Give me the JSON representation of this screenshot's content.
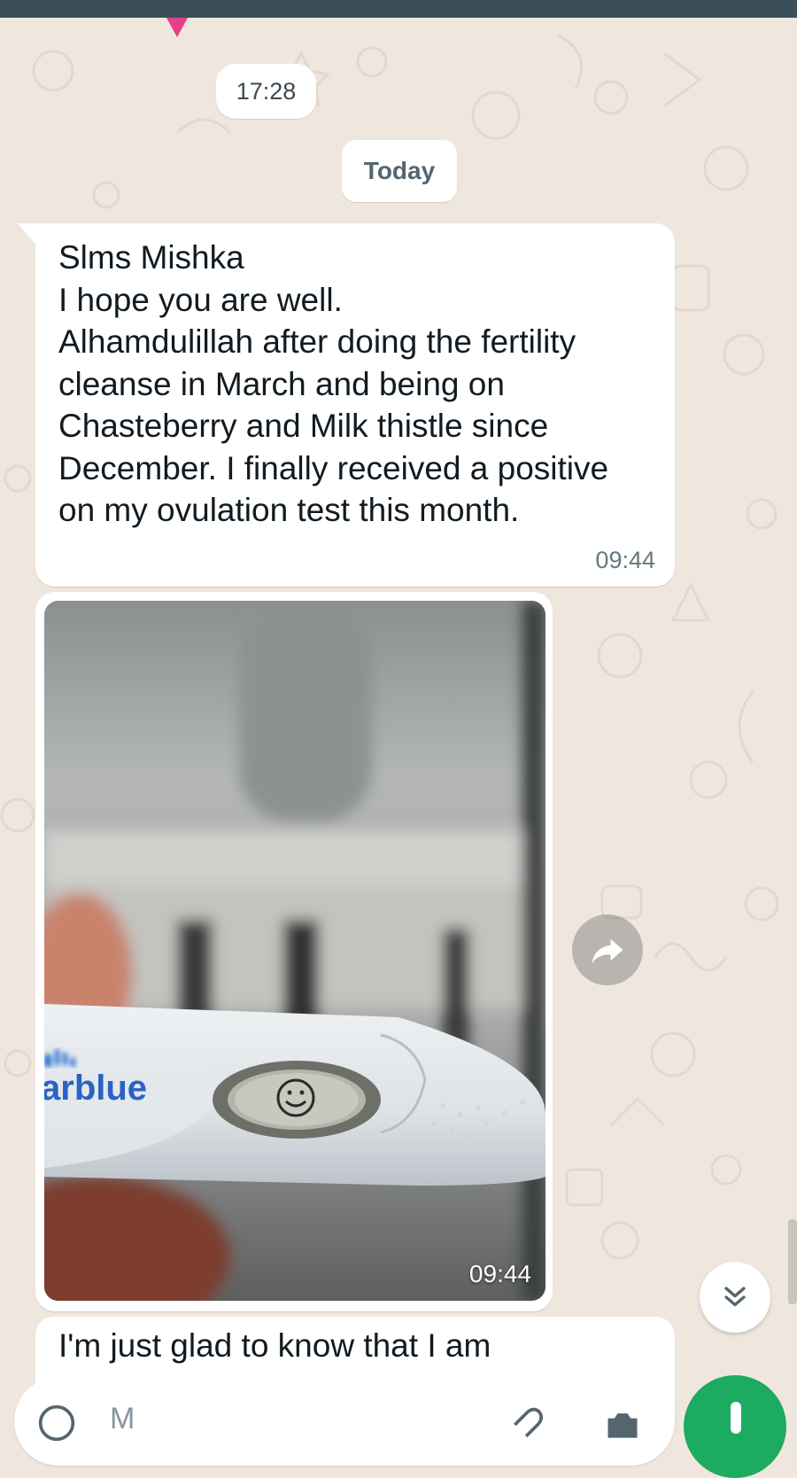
{
  "chat": {
    "time_pill": "17:28",
    "date_divider": "Today",
    "messages": [
      {
        "text": "Slms Mishka\nI hope you are well.\nAlhamdulillah after doing the fertility\ncleanse in March and being on\nChasteberry and Milk thistle since\nDecember. I finally received a positive\non my ovulation test this month.",
        "time": "09:44"
      },
      {
        "type": "image",
        "image_text": "arblue",
        "time": "09:44"
      },
      {
        "text": "I'm just glad to know that I am"
      }
    ]
  },
  "composer": {
    "placeholder": "M",
    "icons": [
      "emoji-icon",
      "attach-icon",
      "camera-icon",
      "mic-icon"
    ]
  },
  "colors": {
    "background": "#efe7de",
    "top_bar": "#3b4f5a",
    "bubble": "#ffffff",
    "timestamp": "#667781",
    "mic_button": "#1daa61",
    "tail_accent": "#e83e8c"
  }
}
